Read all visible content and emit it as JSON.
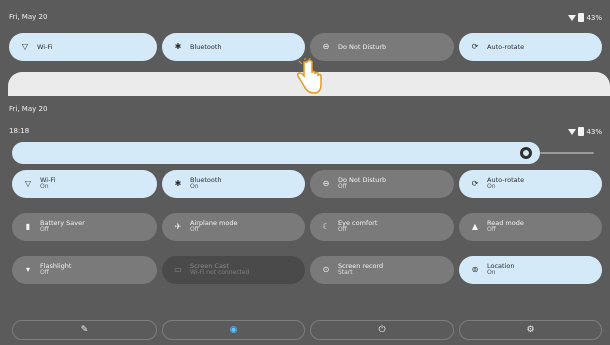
{
  "top": {
    "date": "Fri, May 20",
    "battery": "43%",
    "tiles": [
      {
        "label": "Wi-Fi",
        "state": "on",
        "icon": "wifi-icon"
      },
      {
        "label": "Bluetooth",
        "state": "on",
        "icon": "bluetooth-icon"
      },
      {
        "label": "Do Not Disturb",
        "state": "off",
        "icon": "do-not-disturb-icon"
      },
      {
        "label": "Auto-rotate",
        "state": "on",
        "icon": "auto-rotate-icon"
      }
    ]
  },
  "main": {
    "date": "Fri, May 20",
    "time": "18:18",
    "battery": "43%",
    "tiles": [
      {
        "label": "Wi-Fi",
        "status": "On",
        "state": "on",
        "icon": "wifi-icon"
      },
      {
        "label": "Bluetooth",
        "status": "On",
        "state": "on",
        "icon": "bluetooth-icon"
      },
      {
        "label": "Do Not Disturb",
        "status": "Off",
        "state": "off",
        "icon": "do-not-disturb-icon"
      },
      {
        "label": "Auto-rotate",
        "status": "On",
        "state": "on",
        "icon": "auto-rotate-icon"
      },
      {
        "label": "Battery Saver",
        "status": "Off",
        "state": "off",
        "icon": "battery-saver-icon"
      },
      {
        "label": "Airplane mode",
        "status": "Off",
        "state": "off",
        "icon": "airplane-icon"
      },
      {
        "label": "Eye comfort",
        "status": "Off",
        "state": "off",
        "icon": "eye-comfort-icon"
      },
      {
        "label": "Read mode",
        "status": "Off",
        "state": "off",
        "icon": "read-mode-icon"
      },
      {
        "label": "Flashlight",
        "status": "Off",
        "state": "off",
        "icon": "flashlight-icon"
      },
      {
        "label": "Screen Cast",
        "status": "Wi-Fi not connected",
        "state": "disabled",
        "icon": "screen-cast-icon"
      },
      {
        "label": "Screen record",
        "status": "Start",
        "state": "off",
        "icon": "screen-record-icon"
      },
      {
        "label": "Location",
        "status": "On",
        "state": "on",
        "icon": "location-icon"
      }
    ],
    "bottom": [
      {
        "label": "Edit",
        "icon": "edit-icon"
      },
      {
        "label": "User",
        "icon": "user-icon"
      },
      {
        "label": "Power",
        "icon": "power-icon"
      },
      {
        "label": "Settings",
        "icon": "settings-icon"
      }
    ]
  },
  "colors": {
    "accent": "#d4eaf8",
    "tile_off": "#7a7a7a",
    "background": "#5b5b5b"
  }
}
